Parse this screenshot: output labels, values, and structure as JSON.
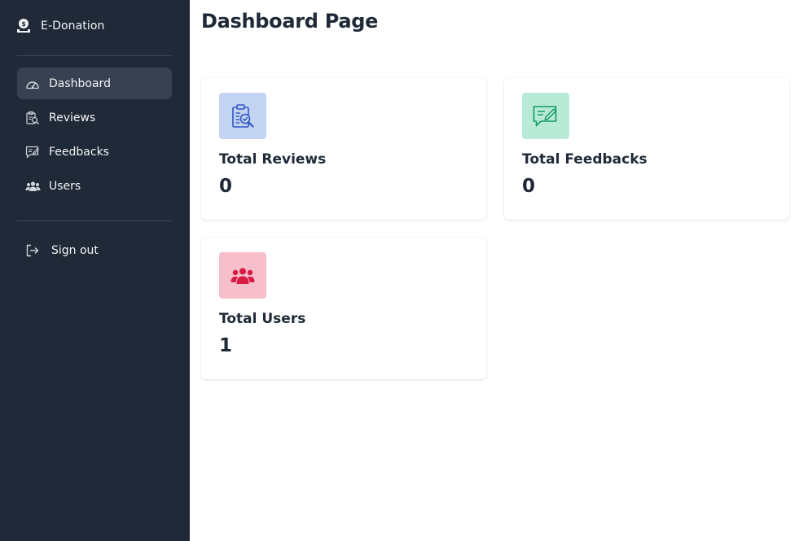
{
  "sidebar": {
    "brand": {
      "label": "E-Donation",
      "icon": "donation-icon"
    },
    "items": [
      {
        "label": "Dashboard",
        "icon": "dashboard-gauge-icon",
        "active": true
      },
      {
        "label": "Reviews",
        "icon": "reviews-icon",
        "active": false
      },
      {
        "label": "Feedbacks",
        "icon": "feedback-icon",
        "active": false
      },
      {
        "label": "Users",
        "icon": "users-icon",
        "active": false
      }
    ],
    "signout": {
      "label": "Sign out",
      "icon": "sign-out-icon"
    }
  },
  "main": {
    "title": "Dashboard Page",
    "cards": [
      {
        "title": "Total Reviews",
        "value": "0",
        "icon": "clipboard-review-icon",
        "bg": "#c3d3f2",
        "fg": "#2f55c6"
      },
      {
        "title": "Total Feedbacks",
        "value": "0",
        "icon": "feedback-chat-icon",
        "bg": "#b9ead7",
        "fg": "#109968"
      },
      {
        "title": "Total Users",
        "value": "1",
        "icon": "users-group-icon",
        "bg": "#f6bfcb",
        "fg": "#d81b45"
      }
    ]
  },
  "colors": {
    "sidebar_bg": "#1f2937",
    "active_item_bg": "#374151",
    "text_dark": "#1f2937"
  }
}
